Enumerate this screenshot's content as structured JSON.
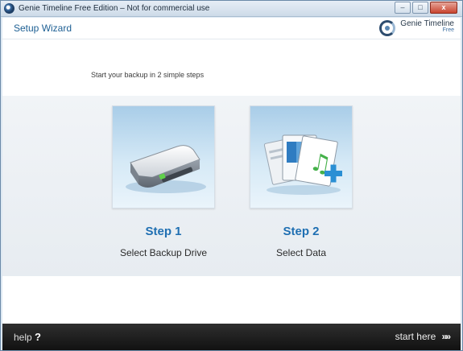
{
  "window": {
    "title": "Genie Timeline Free Edition – Not for commercial use",
    "controls": {
      "minimize": "–",
      "maximize": "□",
      "close": "x"
    }
  },
  "header": {
    "wizard_title": "Setup Wizard",
    "brand_name": "Genie Timeline",
    "brand_sub": "Free"
  },
  "main": {
    "intro": "Start your backup in 2 simple steps",
    "steps": [
      {
        "title": "Step 1",
        "label": "Select Backup Drive",
        "icon": "hard-drive-icon"
      },
      {
        "title": "Step 2",
        "label": "Select Data",
        "icon": "files-add-icon"
      }
    ]
  },
  "footer": {
    "help_label": "help",
    "help_glyph": "?",
    "start_label": "start here",
    "start_glyph": "»»"
  },
  "colors": {
    "accent": "#1f6fb2",
    "footer_bg": "#1a1a1a",
    "tile_top": "#a9cde8"
  }
}
